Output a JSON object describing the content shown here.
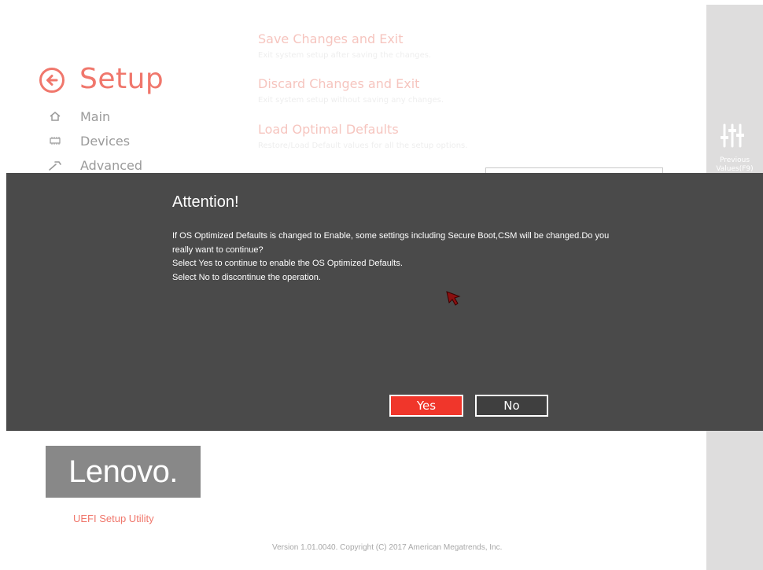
{
  "nav": {
    "title": "Setup",
    "back_icon": "arrow-left-circle-icon",
    "items": [
      {
        "label": "Main",
        "icon": "home-icon"
      },
      {
        "label": "Devices",
        "icon": "devices-icon"
      },
      {
        "label": "Advanced",
        "icon": "wrench-icon"
      }
    ]
  },
  "menu": {
    "items": [
      {
        "title": "Save Changes and Exit",
        "description": "Exit system setup after saving the changes."
      },
      {
        "title": "Discard Changes and Exit",
        "description": "Exit system setup without saving any changes."
      },
      {
        "title": "Load Optimal Defaults",
        "description": "Restore/Load Default values for all the setup options."
      }
    ]
  },
  "side_panel": {
    "icon": "sliders-icon",
    "label_line1": "Previous",
    "label_line2": "Values(F9)"
  },
  "dialog": {
    "title": "Attention!",
    "lines": [
      "If OS Optimized Defaults is changed to Enable, some settings including Secure Boot,CSM will be changed.Do you really want to continue?",
      "Select Yes to continue to enable the OS Optimized Defaults.",
      "Select No  to discontinue the operation."
    ],
    "yes_label": "Yes",
    "no_label": "No"
  },
  "branding": {
    "logo_text": "Lenovo.",
    "utility_label": "UEFI Setup Utility",
    "version": "Version 1.01.0040. Copyright (C) 2017 American Megatrends, Inc."
  },
  "colors": {
    "accent": "#f0776c",
    "dialog_bg": "#4a4a4a",
    "yes_button": "#f0362b",
    "side_panel": "#dedddd",
    "logo_bg": "#888888"
  }
}
